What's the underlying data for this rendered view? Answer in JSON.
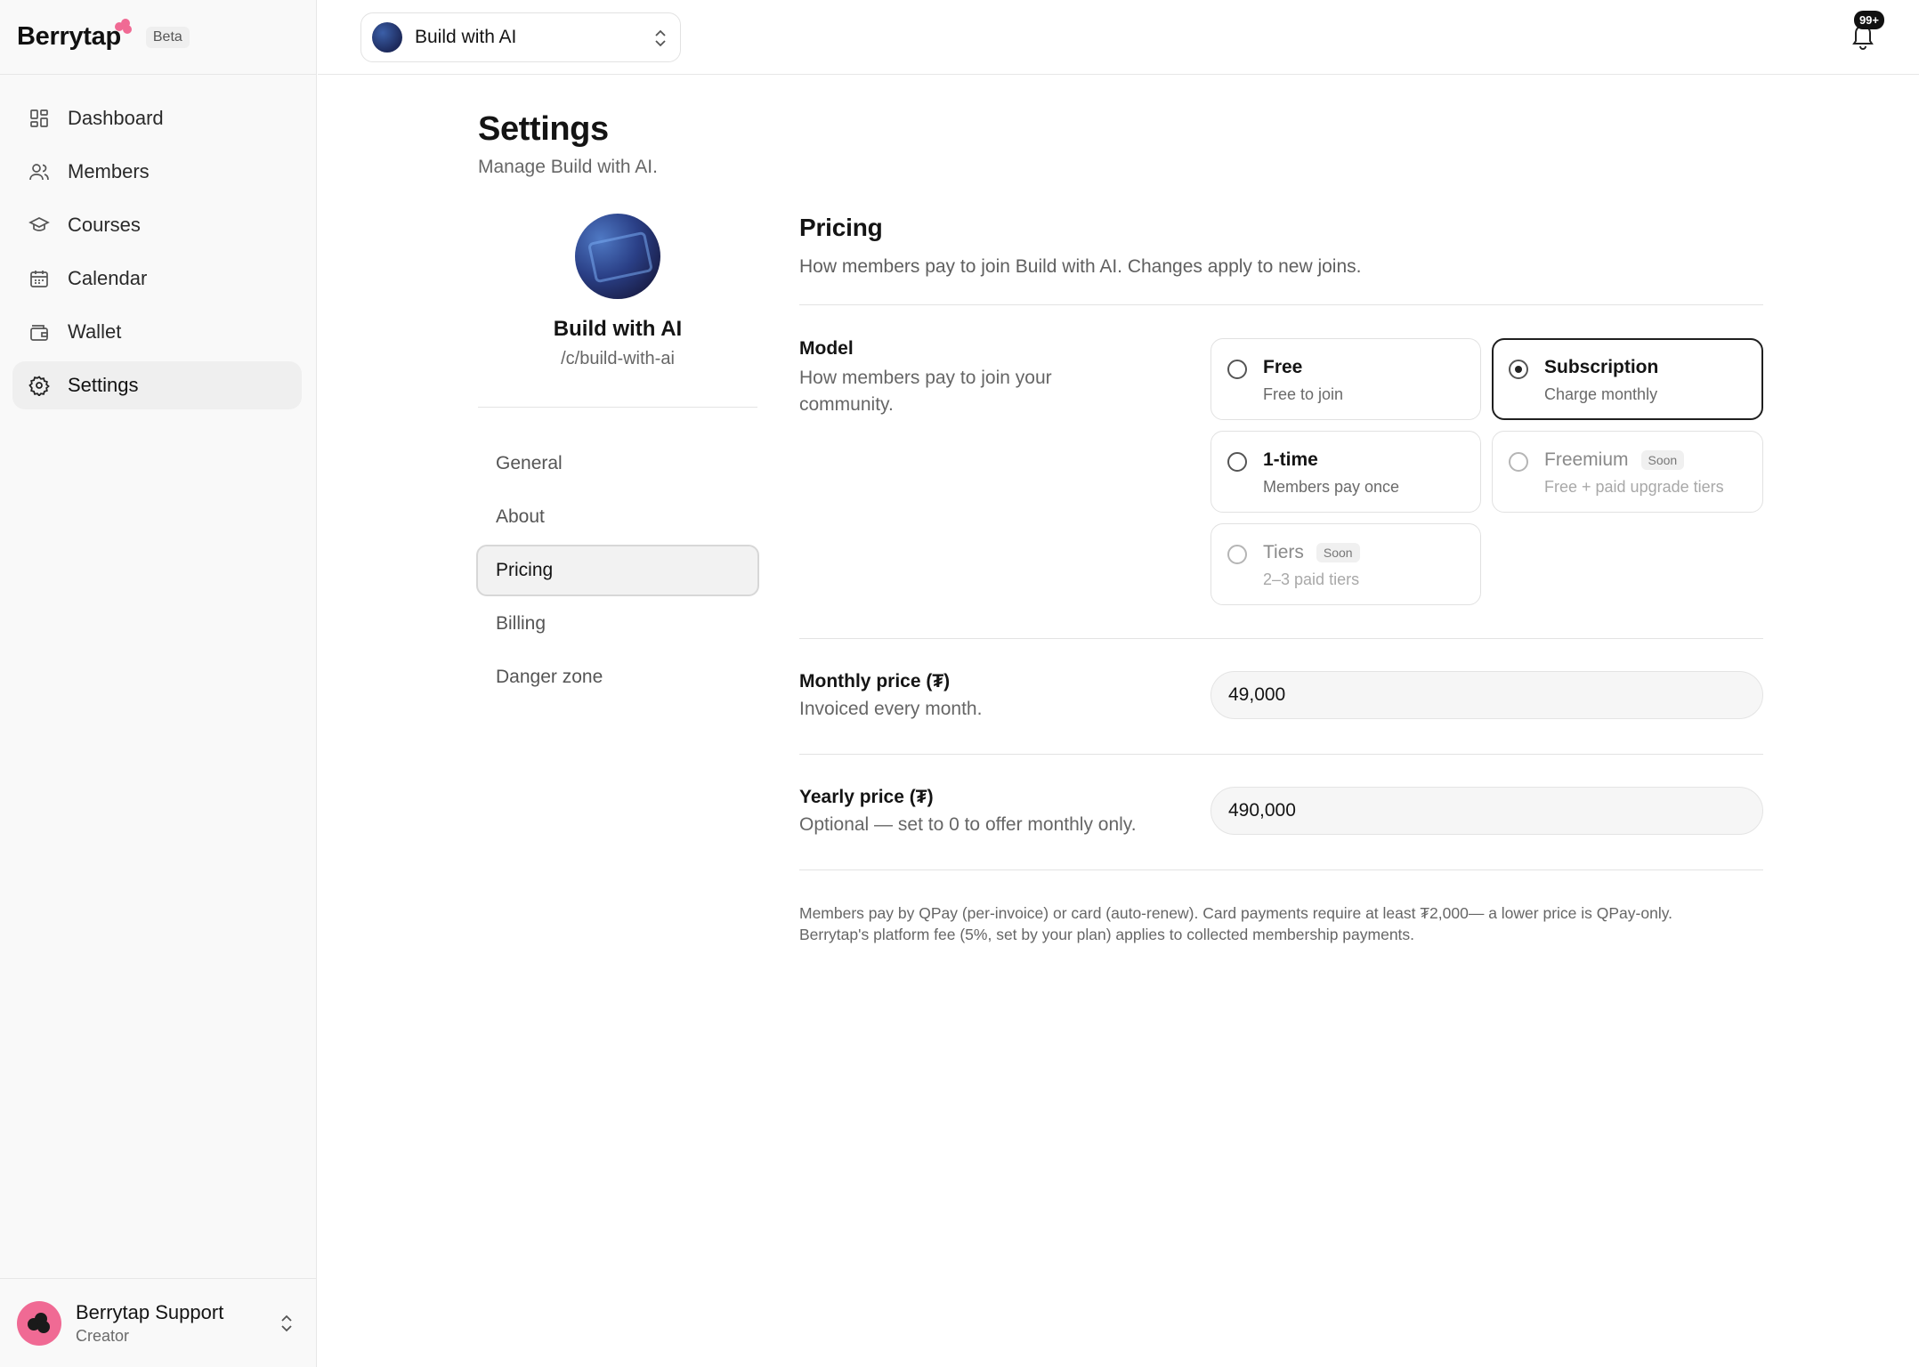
{
  "sidebar": {
    "brand": "Berrytap",
    "beta": "Beta",
    "items": [
      {
        "label": "Dashboard",
        "icon": "dashboard-icon"
      },
      {
        "label": "Members",
        "icon": "members-icon"
      },
      {
        "label": "Courses",
        "icon": "graduation-cap-icon"
      },
      {
        "label": "Calendar",
        "icon": "calendar-icon"
      },
      {
        "label": "Wallet",
        "icon": "wallet-icon"
      },
      {
        "label": "Settings",
        "icon": "gear-icon",
        "active": true
      }
    ],
    "user": {
      "name": "Berrytap Support",
      "role": "Creator"
    }
  },
  "topbar": {
    "community": "Build with AI",
    "notifications_badge": "99+"
  },
  "page": {
    "title": "Settings",
    "subtitle": "Manage Build with AI."
  },
  "profile": {
    "name": "Build with AI",
    "slug": "/c/build-with-ai"
  },
  "subnav": {
    "items": [
      "General",
      "About",
      "Pricing",
      "Billing",
      "Danger zone"
    ],
    "active": "Pricing"
  },
  "pricing": {
    "title": "Pricing",
    "subtitle": "How members pay to join Build with AI. Changes apply to new joins.",
    "model": {
      "label": "Model",
      "help": "How members pay to join your community.",
      "options": [
        {
          "title": "Free",
          "desc": "Free to join",
          "selected": false,
          "disabled": false
        },
        {
          "title": "Subscription",
          "desc": "Charge monthly",
          "selected": true,
          "disabled": false
        },
        {
          "title": "1-time",
          "desc": "Members pay once",
          "selected": false,
          "disabled": false
        },
        {
          "title": "Freemium",
          "desc": "Free + paid upgrade tiers",
          "badge": "Soon",
          "selected": false,
          "disabled": true
        },
        {
          "title": "Tiers",
          "desc": "2–3 paid tiers",
          "badge": "Soon",
          "selected": false,
          "disabled": true
        }
      ]
    },
    "monthly": {
      "label": "Monthly price (₮)",
      "help": "Invoiced every month.",
      "value": "49,000"
    },
    "yearly": {
      "label": "Yearly price (₮)",
      "help": "Optional — set to 0 to offer monthly only.",
      "value": "490,000"
    },
    "note_line1": "Members pay by QPay (per-invoice) or card (auto-renew). Card payments require at least ₮2,000— a lower price is QPay-only.",
    "note_line2": "Berrytap's platform fee (5%, set by your plan) applies to collected membership payments."
  },
  "colors": {
    "brand_berry": "#f06a94",
    "selected_border": "#1f1f1f",
    "sidebar_bg": "#f9f9f9"
  }
}
